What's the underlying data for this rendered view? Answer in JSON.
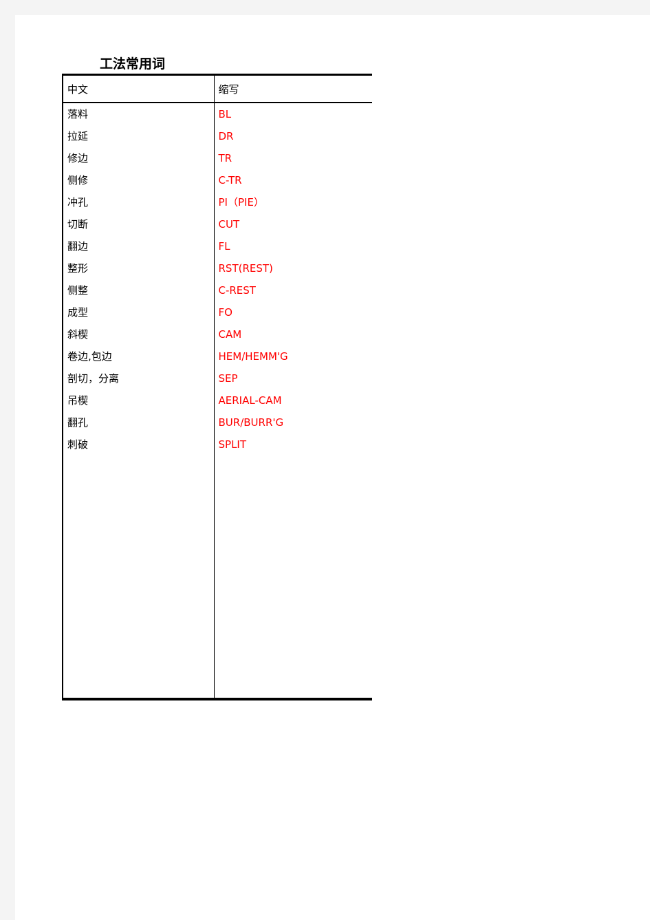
{
  "document": {
    "title": "工法常用词"
  },
  "table": {
    "headers": {
      "chinese": "中文",
      "abbreviation": "缩写"
    },
    "rows": [
      {
        "chinese": "落料",
        "abbreviation": "BL"
      },
      {
        "chinese": "拉延",
        "abbreviation": "DR"
      },
      {
        "chinese": "修边",
        "abbreviation": "TR"
      },
      {
        "chinese": "侧修",
        "abbreviation": "C-TR"
      },
      {
        "chinese": "冲孔",
        "abbreviation": "PI（PIE）"
      },
      {
        "chinese": "切断",
        "abbreviation": "CUT"
      },
      {
        "chinese": "翻边",
        "abbreviation": "FL"
      },
      {
        "chinese": "整形",
        "abbreviation": "RST(REST)"
      },
      {
        "chinese": "侧整",
        "abbreviation": "C-REST"
      },
      {
        "chinese": "成型",
        "abbreviation": "FO"
      },
      {
        "chinese": "斜楔",
        "abbreviation": "CAM"
      },
      {
        "chinese": "卷边,包边",
        "abbreviation": "HEM/HEMM'G"
      },
      {
        "chinese": "剖切，分离",
        "abbreviation": "SEP"
      },
      {
        "chinese": "吊楔",
        "abbreviation": "AERIAL-CAM"
      },
      {
        "chinese": "翻孔",
        "abbreviation": "BUR/BURR'G"
      },
      {
        "chinese": "刺破",
        "abbreviation": "SPLIT"
      }
    ],
    "empty_row_count": 11
  },
  "colors": {
    "abbreviation_text": "#ff0000",
    "chinese_text": "#000000",
    "border": "#000000",
    "page_background": "#ffffff",
    "frame_background": "#f4f4f4"
  }
}
